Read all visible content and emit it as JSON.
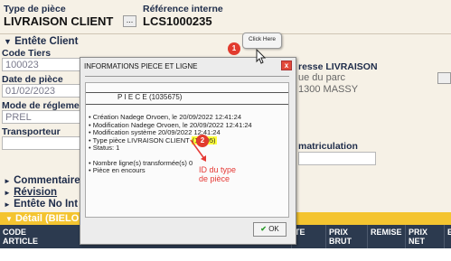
{
  "header": {
    "type_piece_label": "Type de pièce",
    "type_piece_value": "LIVRAISON CLIENT",
    "dots": "...",
    "ref_interne_label": "Référence interne",
    "ref_interne_value": "LCS1000235"
  },
  "entete_client": {
    "title": "Entête Client",
    "code_tiers_label": "Code Tiers",
    "code_tiers_value": "100023",
    "date_piece_label": "Date de pièce",
    "date_piece_value": "01/02/2023",
    "mode_reglement_label": "Mode de réglemen",
    "mode_reglement_value": "PREL",
    "transporteur_label": "Transporteur",
    "adresse_label": "resse LIVRAISON",
    "adresse_line1": "ue du parc",
    "adresse_line2": "1300  MASSY",
    "immat_label": "matriculation"
  },
  "sections": [
    "Commentaire",
    "Révision",
    "Entête No Int"
  ],
  "detail": {
    "title": "Détail (BIELO",
    "columns": [
      "CODE ARTICLE",
      "TE",
      "PRIX BRUT",
      "REMISE",
      "PRIX NET",
      "E"
    ]
  },
  "dialog": {
    "title": "INFORMATIONS PIECE ET LIGNE",
    "close": "x",
    "piece_heading": "P I E C E  (1035675)",
    "lines": [
      "Création      Nadege Orvoen,  le 20/09/2022 12:41:24",
      "Modification Nadege Orvoen,  le 20/09/2022 12:41:24",
      "Modification système 20/09/2022 12:41:24",
      "Type pièce    LIVRAISON CLIENT",
      "Status: 1"
    ],
    "type_code": "(10005)",
    "lines2": [
      "Nombre ligne(s) transformée(s)   0",
      "Pièce en encours"
    ],
    "ok_label": "OK",
    "ok_check": "✔"
  },
  "annotations": {
    "badge1": "1",
    "badge2": "2",
    "tooltip": "Click Here",
    "note": "ID du type\nde pièce",
    "colors": {
      "badge": "#e23b2e",
      "highlight": "#ffff3a",
      "note": "#e53935"
    }
  }
}
